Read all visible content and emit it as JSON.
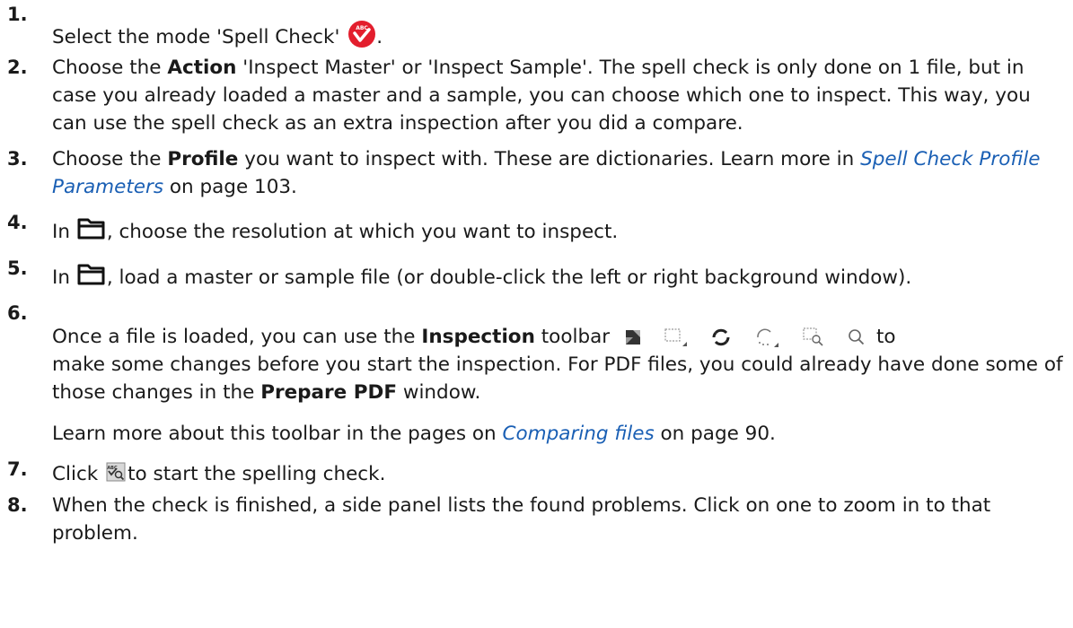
{
  "steps": [
    {
      "num": "1.",
      "pre": "Select the mode 'Spell Check'",
      "post": "."
    },
    {
      "num": "2.",
      "pre": "Choose the",
      "bold": "Action",
      "post": "'Inspect Master' or 'Inspect Sample'. The spell check is only done on 1 file, but in case you already loaded a master and a sample, you can choose which one to inspect. This way, you can use the spell check as an extra inspection after you did a compare."
    },
    {
      "num": "3.",
      "pre": "Choose the",
      "bold": "Profile",
      "mid": "you want to inspect with. These are dictionaries. Learn more in",
      "link": "Spell Check Profile Parameters",
      "post": "on page 103."
    },
    {
      "num": "4.",
      "pre": "In",
      "post": ", choose the resolution at which you want to inspect."
    },
    {
      "num": "5.",
      "pre": "In",
      "post": ", load a master or sample file (or double-click the left or right background window)."
    },
    {
      "num": "6.",
      "pre": "Once a file is loaded, you can use the",
      "bold": "Inspection",
      "mid": "toolbar",
      "post": "to",
      "cont": "make some changes before you start the inspection. For PDF files, you could already have done some of those changes in the",
      "bold2": "Prepare PDF",
      "post2": "window.",
      "para2_pre": "Learn more about this toolbar in the pages on",
      "para2_link": "Comparing files",
      "para2_post": "on page 90."
    },
    {
      "num": "7.",
      "pre": "Click",
      "post": "to start the spelling check."
    },
    {
      "num": "8.",
      "text": "When the check is finished, a side panel lists the found problems. Click on one to zoom in to that problem."
    }
  ],
  "icons": {
    "abc_badge_text": "ABC",
    "abc_color": "#e31e2d",
    "link_color": "#1a5fb4"
  }
}
